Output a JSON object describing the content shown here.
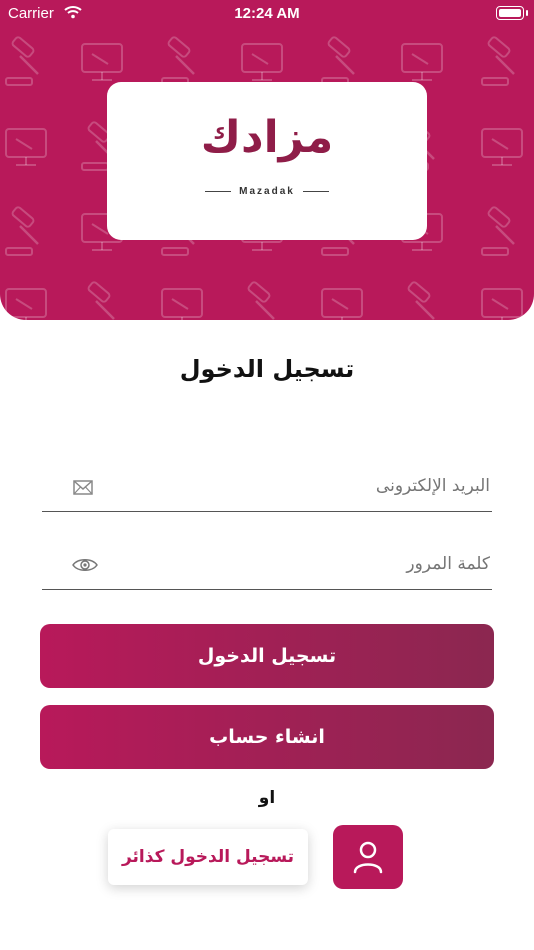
{
  "status_bar": {
    "carrier": "Carrier",
    "time": "12:24 AM"
  },
  "logo": {
    "arabic": "مزادك",
    "english": "Mazadak"
  },
  "login": {
    "title": "تسجيل الدخول",
    "email_placeholder": "البريد الإلكترونى",
    "password_placeholder": "كلمة المرور",
    "login_button": "تسجيل الدخول",
    "register_button": "انشاء حساب",
    "or_label": "او",
    "visitor_login_button": "تسجيل الدخول كذائر"
  },
  "icons": {
    "email": "envelope-icon",
    "password": "eye-icon",
    "user": "user-icon"
  },
  "colors": {
    "brand": "#b8195a",
    "brand_dark": "#8b2750",
    "logo_text": "#8f1d48"
  }
}
